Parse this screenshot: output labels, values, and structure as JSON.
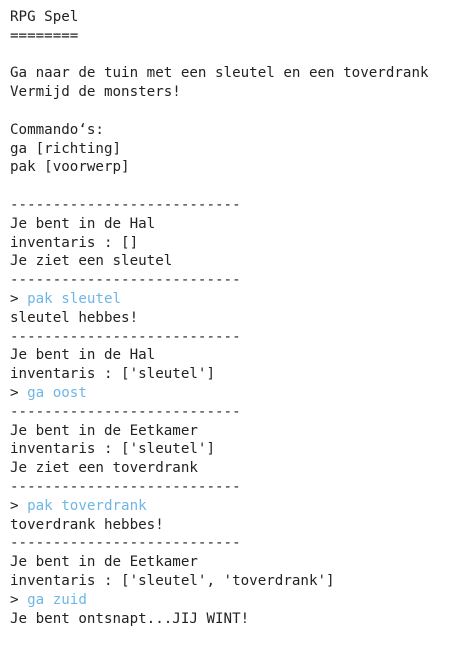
{
  "colors": {
    "background": "#ffffff",
    "text": "#222222",
    "command": "#6fb6e6"
  },
  "lines": [
    {
      "type": "text",
      "text": "RPG Spel"
    },
    {
      "type": "text",
      "text": "========"
    },
    {
      "type": "blank",
      "text": ""
    },
    {
      "type": "text",
      "text": "Ga naar de tuin met een sleutel en een toverdrank"
    },
    {
      "type": "text",
      "text": "Vermijd de monsters!"
    },
    {
      "type": "blank",
      "text": ""
    },
    {
      "type": "text",
      "text": "Commando‘s:"
    },
    {
      "type": "text",
      "text": "ga [richting]"
    },
    {
      "type": "text",
      "text": "pak [voorwerp]"
    },
    {
      "type": "blank",
      "text": ""
    },
    {
      "type": "text",
      "text": "---------------------------"
    },
    {
      "type": "text",
      "text": "Je bent in de Hal"
    },
    {
      "type": "text",
      "text": "inventaris : []"
    },
    {
      "type": "text",
      "text": "Je ziet een sleutel"
    },
    {
      "type": "text",
      "text": "---------------------------"
    },
    {
      "type": "input",
      "prompt": "> ",
      "text": "pak sleutel"
    },
    {
      "type": "text",
      "text": "sleutel hebbes!"
    },
    {
      "type": "text",
      "text": "---------------------------"
    },
    {
      "type": "text",
      "text": "Je bent in de Hal"
    },
    {
      "type": "text",
      "text": "inventaris : ['sleutel']"
    },
    {
      "type": "input",
      "prompt": "> ",
      "text": "ga oost"
    },
    {
      "type": "text",
      "text": "---------------------------"
    },
    {
      "type": "text",
      "text": "Je bent in de Eetkamer"
    },
    {
      "type": "text",
      "text": "inventaris : ['sleutel']"
    },
    {
      "type": "text",
      "text": "Je ziet een toverdrank"
    },
    {
      "type": "text",
      "text": "---------------------------"
    },
    {
      "type": "input",
      "prompt": "> ",
      "text": "pak toverdrank"
    },
    {
      "type": "text",
      "text": "toverdrank hebbes!"
    },
    {
      "type": "text",
      "text": "---------------------------"
    },
    {
      "type": "text",
      "text": "Je bent in de Eetkamer"
    },
    {
      "type": "text",
      "text": "inventaris : ['sleutel', 'toverdrank']"
    },
    {
      "type": "input",
      "prompt": "> ",
      "text": "ga zuid"
    },
    {
      "type": "text",
      "text": "Je bent ontsnapt...JIJ WINT!"
    }
  ]
}
